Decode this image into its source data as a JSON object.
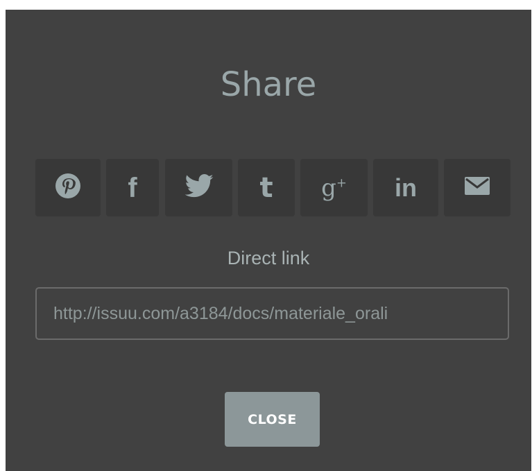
{
  "dialog": {
    "title": "Share",
    "colors": {
      "background": "#414141",
      "button_background": "#383838",
      "icon_color": "#9aa7a9",
      "close_button_background": "#8c9799"
    }
  },
  "share_buttons": [
    {
      "network": "pinterest",
      "icon": "pinterest-icon"
    },
    {
      "network": "facebook",
      "icon": "facebook-icon",
      "glyph": "f"
    },
    {
      "network": "twitter",
      "icon": "twitter-icon"
    },
    {
      "network": "tumblr",
      "icon": "tumblr-icon",
      "glyph": "t"
    },
    {
      "network": "google-plus",
      "icon": "google-plus-icon",
      "glyph": "g",
      "sup": "+"
    },
    {
      "network": "linkedin",
      "icon": "linkedin-icon",
      "glyph": "in"
    },
    {
      "network": "email",
      "icon": "envelope-icon"
    }
  ],
  "direct_link": {
    "label": "Direct link",
    "value": "http://issuu.com/a3184/docs/materiale_orali"
  },
  "close_button": {
    "label": "CLOSE"
  }
}
